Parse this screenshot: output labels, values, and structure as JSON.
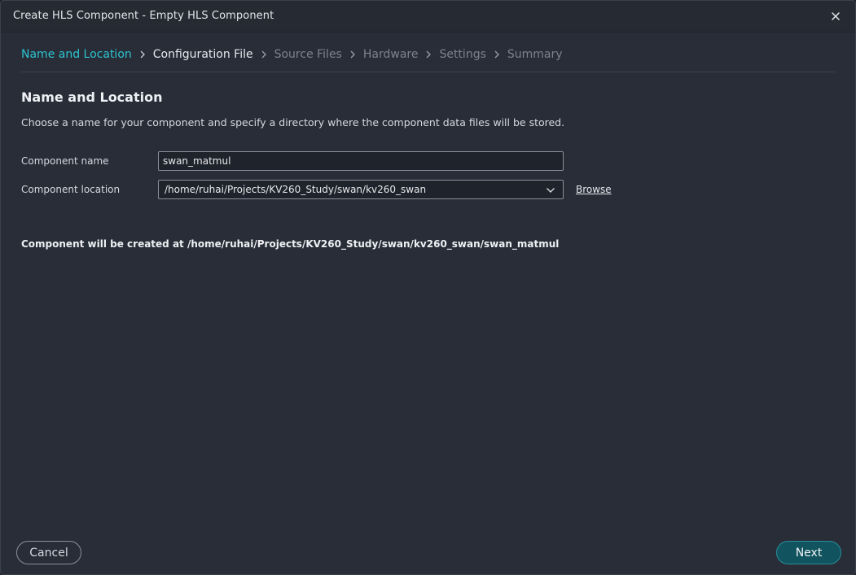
{
  "window": {
    "title": "Create HLS Component - Empty HLS Component"
  },
  "steps": [
    {
      "label": "Name and Location",
      "state": "active"
    },
    {
      "label": "Configuration File",
      "state": "next"
    },
    {
      "label": "Source Files",
      "state": "disabled"
    },
    {
      "label": "Hardware",
      "state": "disabled"
    },
    {
      "label": "Settings",
      "state": "disabled"
    },
    {
      "label": "Summary",
      "state": "disabled"
    }
  ],
  "section": {
    "title": "Name and Location",
    "description": "Choose a name for your component and specify a directory where the component data files will be stored."
  },
  "form": {
    "name_label": "Component name",
    "name_value": "swan_matmul",
    "location_label": "Component location",
    "location_value": "/home/ruhai/Projects/KV260_Study/swan/kv260_swan",
    "browse_label": "Browse"
  },
  "result": {
    "text": "Component will be created at /home/ruhai/Projects/KV260_Study/swan/kv260_swan/swan_matmul"
  },
  "buttons": {
    "cancel": "Cancel",
    "next": "Next"
  },
  "colors": {
    "accent": "#2ec4cf",
    "background": "#282d38",
    "primary_button": "#11545f"
  }
}
